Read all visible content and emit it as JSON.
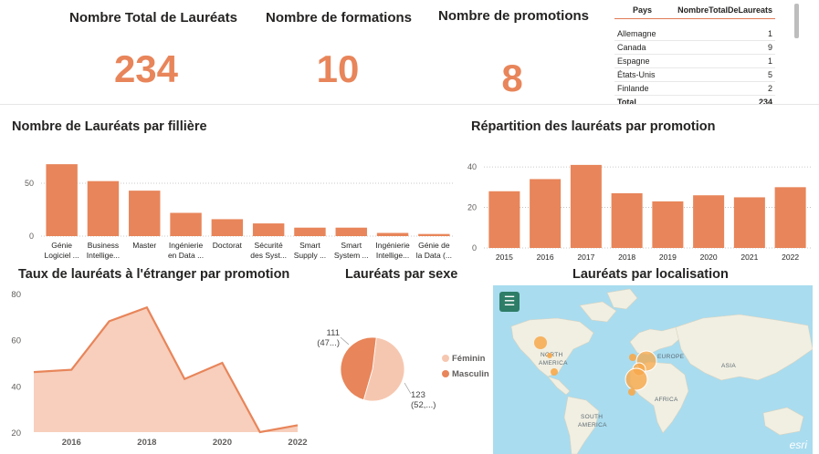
{
  "kpis": [
    {
      "title": "Nombre Total de Lauréats",
      "value": "234"
    },
    {
      "title": "Nombre de formations",
      "value": "10"
    },
    {
      "title": "Nombre de promotions",
      "value": "8"
    }
  ],
  "country_table": {
    "headers": [
      "Pays",
      "NombreTotalDeLaureats"
    ],
    "rows": [
      [
        "Allemagne",
        "1"
      ],
      [
        "Canada",
        "9"
      ],
      [
        "Espagne",
        "1"
      ],
      [
        "États-Unis",
        "5"
      ],
      [
        "Finlande",
        "2"
      ]
    ],
    "total": [
      "Total",
      "234"
    ]
  },
  "titles": {
    "filiere": "Nombre de Lauréats par fillière",
    "promotion": "Répartition des lauréats par promotion",
    "etranger": "Taux de lauréats à l'étranger par promotion",
    "sexe": "Lauréats par sexe",
    "localisation": "Lauréats par localisation"
  },
  "map": {
    "labels": [
      "NORTH",
      "AMERICA",
      "EUROPE",
      "ASIA",
      "AFRICA",
      "SOUTH",
      "AMERICA"
    ],
    "attribution": "esri",
    "menu_icon": "menu-icon"
  },
  "colors": {
    "accent": "#e8855a",
    "accent_light": "#f6c7b0",
    "accent_dark": "#e07b55",
    "map_water": "#a9dcef",
    "map_land": "#f1efe2"
  },
  "chart_data": [
    {
      "type": "bar",
      "categories": [
        "Génie Logiciel ...",
        "Business Intellige...",
        "Master",
        "Ingénierie en Data ...",
        "Doctorat",
        "Sécurité des Syst...",
        "Smart Supply ...",
        "Smart System ...",
        "Ingénierie Intellige...",
        "Génie de la Data (..."
      ],
      "category_lines": [
        [
          "Génie",
          "Logiciel ..."
        ],
        [
          "Business",
          "Intellige..."
        ],
        [
          "Master"
        ],
        [
          "Ingénierie",
          "en Data ..."
        ],
        [
          "Doctorat"
        ],
        [
          "Sécurité",
          "des Syst..."
        ],
        [
          "Smart",
          "Supply ..."
        ],
        [
          "Smart",
          "System ..."
        ],
        [
          "Ingénierie",
          "Intellige..."
        ],
        [
          "Génie de",
          "la Data (..."
        ]
      ],
      "values": [
        68,
        52,
        43,
        22,
        16,
        12,
        8,
        8,
        3,
        2
      ],
      "yticks": [
        0,
        50
      ],
      "ylim": [
        0,
        75
      ],
      "grid": true
    },
    {
      "type": "bar",
      "categories": [
        "2015",
        "2016",
        "2017",
        "2018",
        "2019",
        "2020",
        "2021",
        "2022"
      ],
      "values": [
        28,
        34,
        41,
        27,
        23,
        26,
        25,
        30
      ],
      "yticks": [
        0,
        20,
        40
      ],
      "ylim": [
        0,
        45
      ],
      "grid": true
    },
    {
      "type": "area",
      "x": [
        2015,
        2016,
        2017,
        2018,
        2019,
        2020,
        2021,
        2022
      ],
      "values": [
        46,
        47,
        68,
        74,
        43,
        50,
        20,
        23
      ],
      "xticks": [
        "2016",
        "2018",
        "2020",
        "2022"
      ],
      "yticks": [
        20,
        40,
        60,
        80
      ],
      "ylim": [
        20,
        80
      ]
    },
    {
      "type": "pie",
      "series": [
        {
          "name": "Féminin",
          "value": 123,
          "label": "123",
          "label2": "(52,...)"
        },
        {
          "name": "Masculin",
          "value": 111,
          "label": "111",
          "label2": "(47...)"
        }
      ],
      "legend": "right"
    }
  ]
}
